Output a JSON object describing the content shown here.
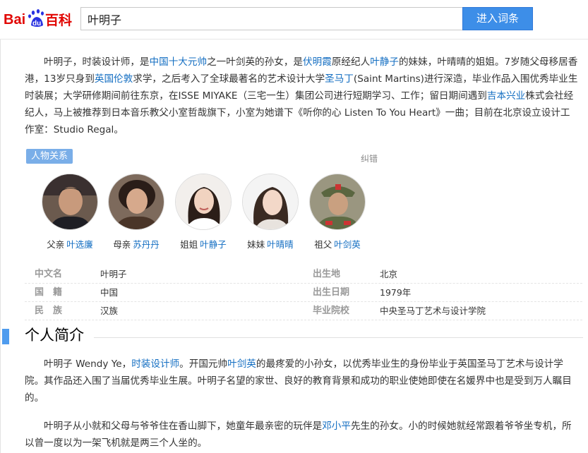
{
  "header": {
    "logo_text": "Baidu百科",
    "search_value": "叶明子",
    "search_button": "进入词条"
  },
  "intro": {
    "segments": [
      {
        "t": "叶明子，时装设计师，是"
      },
      {
        "t": "中国十大元帅",
        "link": true
      },
      {
        "t": "之一叶剑英的孙女，是"
      },
      {
        "t": "伏明霞",
        "link": true
      },
      {
        "t": "原经纪人"
      },
      {
        "t": "叶静子",
        "link": true
      },
      {
        "t": "的妹妹，叶晴晴的姐姐。7岁随父母移居香港，13岁只身到"
      },
      {
        "t": "英国伦敦",
        "link": true
      },
      {
        "t": "求学，之后考入了全球最著名的艺术设计大学"
      },
      {
        "t": "圣马丁",
        "link": true
      },
      {
        "t": "(Saint Martins)进行深造，毕业作品入围优秀毕业生时装展；大学研修期间前往东京，在ISSE MIYAKE（三宅一生）集团公司进行短期学习、工作；留日期间遇到"
      },
      {
        "t": "吉本兴业",
        "link": true
      },
      {
        "t": "株式会社经纪人，马上被推荐到日本音乐教父小室哲哉旗下，小室为她谱下《听你的心 Listen To You Heart》一曲；目前在北京设立设计工作室：Studio Regal。"
      }
    ]
  },
  "relations": {
    "tag": "人物关系",
    "correction": "纠错",
    "people": [
      {
        "relation": "父亲",
        "name": "叶选廉"
      },
      {
        "relation": "母亲",
        "name": "苏丹丹"
      },
      {
        "relation": "姐姐",
        "name": "叶静子"
      },
      {
        "relation": "妹妹",
        "name": "叶晴晴"
      },
      {
        "relation": "祖父",
        "name": "叶剑英"
      }
    ]
  },
  "basic_info": {
    "rows": [
      {
        "k1": "中文名",
        "v1": "叶明子",
        "k2": "出生地",
        "v2": "北京"
      },
      {
        "k1": "国　籍",
        "v1": "中国",
        "k2": "出生日期",
        "v2": "1979年"
      },
      {
        "k1": "民　族",
        "v1": "汉族",
        "k2": "毕业院校",
        "v2": "中央圣马丁艺术与设计学院"
      }
    ]
  },
  "section": {
    "title": "个人简介"
  },
  "bio1": {
    "segments": [
      {
        "t": "叶明子 Wendy Ye，"
      },
      {
        "t": "时装设计师",
        "link": true
      },
      {
        "t": "。开国元帅"
      },
      {
        "t": "叶剑英",
        "link": true
      },
      {
        "t": "的最疼爱的小孙女，以优秀毕业生的身份毕业于英国圣马丁艺术与设计学院。其作品还入围了当届优秀毕业生展。叶明子名望的家世、良好的教育背景和成功的职业使她即使在名媛界中也是受到万人瞩目的。"
      }
    ]
  },
  "bio2": {
    "segments": [
      {
        "t": "叶明子从小就和父母与爷爷住在香山脚下，她童年最亲密的玩伴是"
      },
      {
        "t": "邓小平",
        "link": true
      },
      {
        "t": "先生的孙女。小的时候她就经常跟着爷爷坐专机，所以曾一度以为一架飞机就是两三个人坐的。"
      }
    ]
  },
  "colors": {
    "link": "#136ec2",
    "accent": "#3d8ee8",
    "tag_bg": "#7aaee8",
    "logo_red": "#e10602",
    "logo_blue": "#2932e1"
  }
}
